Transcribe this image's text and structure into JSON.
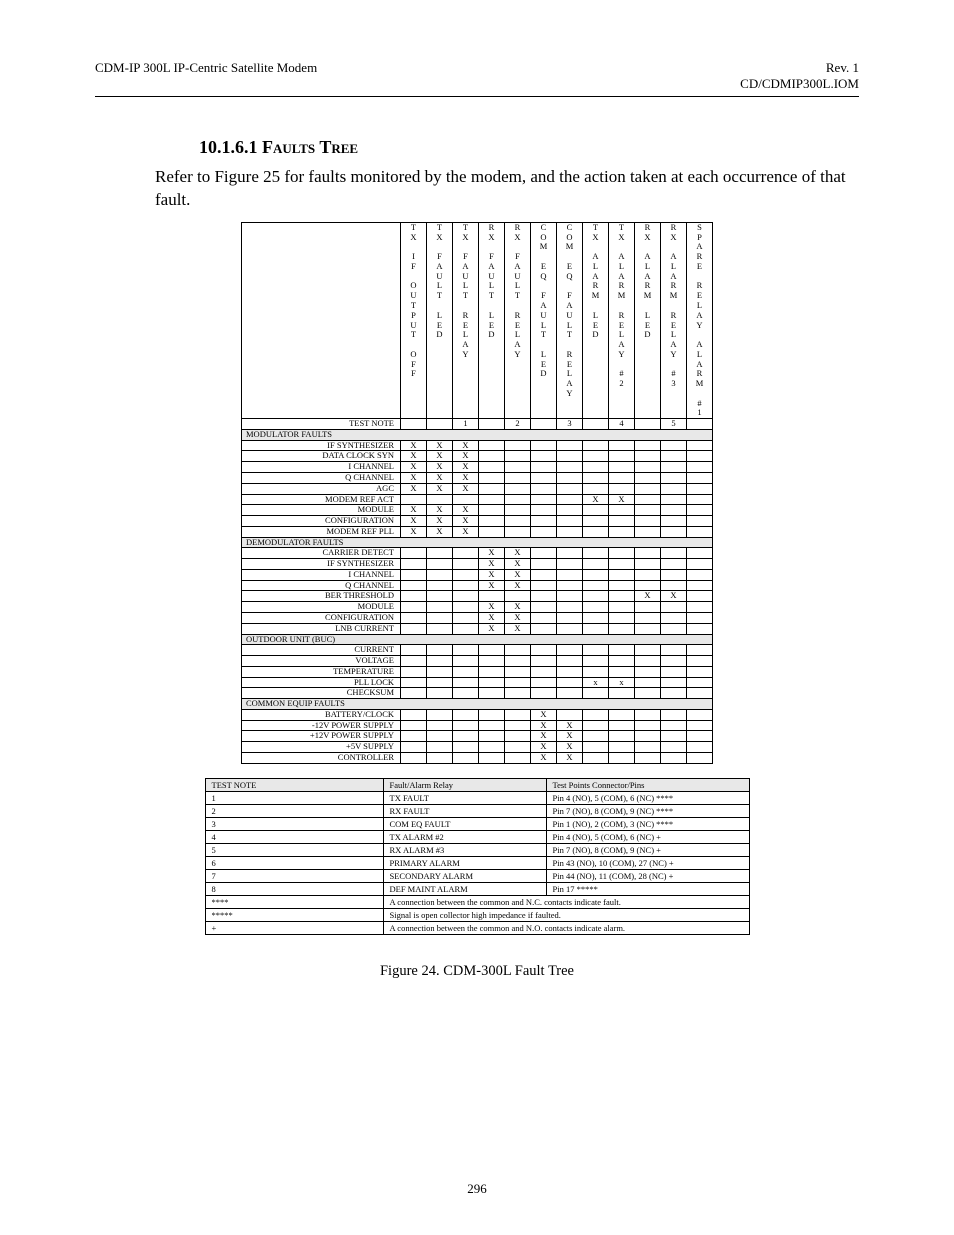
{
  "header": {
    "left": "CDM-IP 300L IP-Centric Satellite Modem",
    "right1": "Rev. 1",
    "right2": "CD/CDMIP300L.IOM"
  },
  "heading": {
    "number": "10.1.6.1 ",
    "title": "Faults Tree"
  },
  "intro": "Refer to Figure 25 for faults monitored by the modem, and the action taken at each occurrence of that fault.",
  "caption": "Figure 24.  CDM-300L Fault Tree",
  "page_number": "296",
  "columns": [
    "TX IF OUTPUT OFF",
    "TX FAULT LED",
    "TX FAULT RELAY",
    "RX FAULT LED",
    "RX FAULT RELAY",
    "COM EQ FAULT LED",
    "COM EQ FAULT RELAY",
    "TX ALARM LED",
    "TX ALARM RELAY #2",
    "RX ALARM LED",
    "RX ALARM RELAY #3",
    "SPARE RELAY ALARM #1"
  ],
  "test_note_row": {
    "label": "TEST NOTE",
    "cells": [
      "",
      "",
      "1",
      "",
      "2",
      "",
      "3",
      "",
      "4",
      "",
      "5",
      ""
    ]
  },
  "sections": [
    {
      "title": "MODULATOR FAULTS",
      "rows": [
        {
          "label": "IF SYNTHESIZER",
          "cells": [
            "X",
            "X",
            "X",
            "",
            "",
            "",
            "",
            "",
            "",
            "",
            "",
            ""
          ]
        },
        {
          "label": "DATA CLOCK SYN",
          "cells": [
            "X",
            "X",
            "X",
            "",
            "",
            "",
            "",
            "",
            "",
            "",
            "",
            ""
          ]
        },
        {
          "label": "I CHANNEL",
          "cells": [
            "X",
            "X",
            "X",
            "",
            "",
            "",
            "",
            "",
            "",
            "",
            "",
            ""
          ]
        },
        {
          "label": "Q CHANNEL",
          "cells": [
            "X",
            "X",
            "X",
            "",
            "",
            "",
            "",
            "",
            "",
            "",
            "",
            ""
          ]
        },
        {
          "label": "AGC",
          "cells": [
            "X",
            "X",
            "X",
            "",
            "",
            "",
            "",
            "",
            "",
            "",
            "",
            ""
          ]
        },
        {
          "label": "MODEM REF ACT",
          "cells": [
            "",
            "",
            "",
            "",
            "",
            "",
            "",
            "X",
            "X",
            "",
            "",
            ""
          ]
        },
        {
          "label": "MODULE",
          "cells": [
            "X",
            "X",
            "X",
            "",
            "",
            "",
            "",
            "",
            "",
            "",
            "",
            ""
          ]
        },
        {
          "label": "CONFIGURATION",
          "cells": [
            "X",
            "X",
            "X",
            "",
            "",
            "",
            "",
            "",
            "",
            "",
            "",
            ""
          ]
        },
        {
          "label": "MODEM REF PLL",
          "cells": [
            "X",
            "X",
            "X",
            "",
            "",
            "",
            "",
            "",
            "",
            "",
            "",
            ""
          ]
        }
      ]
    },
    {
      "title": "DEMODULATOR FAULTS",
      "rows": [
        {
          "label": "CARRIER DETECT",
          "cells": [
            "",
            "",
            "",
            "X",
            "X",
            "",
            "",
            "",
            "",
            "",
            "",
            ""
          ]
        },
        {
          "label": "IF SYNTHESIZER",
          "cells": [
            "",
            "",
            "",
            "X",
            "X",
            "",
            "",
            "",
            "",
            "",
            "",
            ""
          ]
        },
        {
          "label": "I CHANNEL",
          "cells": [
            "",
            "",
            "",
            "X",
            "X",
            "",
            "",
            "",
            "",
            "",
            "",
            ""
          ]
        },
        {
          "label": "Q CHANNEL",
          "cells": [
            "",
            "",
            "",
            "X",
            "X",
            "",
            "",
            "",
            "",
            "",
            "",
            ""
          ]
        },
        {
          "label": "BER THRESHOLD",
          "cells": [
            "",
            "",
            "",
            "",
            "",
            "",
            "",
            "",
            "",
            "X",
            "X",
            ""
          ]
        },
        {
          "label": "MODULE",
          "cells": [
            "",
            "",
            "",
            "X",
            "X",
            "",
            "",
            "",
            "",
            "",
            "",
            ""
          ]
        },
        {
          "label": "CONFIGURATION",
          "cells": [
            "",
            "",
            "",
            "X",
            "X",
            "",
            "",
            "",
            "",
            "",
            "",
            ""
          ]
        },
        {
          "label": "LNB CURRENT",
          "cells": [
            "",
            "",
            "",
            "X",
            "X",
            "",
            "",
            "",
            "",
            "",
            "",
            ""
          ]
        }
      ]
    },
    {
      "title": "OUTDOOR UNIT (BUC)",
      "rows": [
        {
          "label": "CURRENT",
          "cells": [
            "",
            "",
            "",
            "",
            "",
            "",
            "",
            "",
            "",
            "",
            "",
            ""
          ]
        },
        {
          "label": "VOLTAGE",
          "cells": [
            "",
            "",
            "",
            "",
            "",
            "",
            "",
            "",
            "",
            "",
            "",
            ""
          ]
        },
        {
          "label": "TEMPERATURE",
          "cells": [
            "",
            "",
            "",
            "",
            "",
            "",
            "",
            "",
            "",
            "",
            "",
            ""
          ]
        },
        {
          "label": "PLL LOCK",
          "cells": [
            "",
            "",
            "",
            "",
            "",
            "",
            "",
            "x",
            "x",
            "",
            "",
            ""
          ]
        },
        {
          "label": "CHECKSUM",
          "cells": [
            "",
            "",
            "",
            "",
            "",
            "",
            "",
            "",
            "",
            "",
            "",
            ""
          ]
        }
      ]
    },
    {
      "title": "COMMON EQUIP FAULTS",
      "rows": [
        {
          "label": "BATTERY/CLOCK",
          "cells": [
            "",
            "",
            "",
            "",
            "",
            "X",
            "",
            "",
            "",
            "",
            "",
            ""
          ]
        },
        {
          "label": "-12V POWER SUPPLY",
          "cells": [
            "",
            "",
            "",
            "",
            "",
            "X",
            "X",
            "",
            "",
            "",
            "",
            ""
          ]
        },
        {
          "label": "+12V POWER SUPPLY",
          "cells": [
            "",
            "",
            "",
            "",
            "",
            "X",
            "X",
            "",
            "",
            "",
            "",
            ""
          ]
        },
        {
          "label": "+5V SUPPLY",
          "cells": [
            "",
            "",
            "",
            "",
            "",
            "X",
            "X",
            "",
            "",
            "",
            "",
            ""
          ]
        },
        {
          "label": "CONTROLLER",
          "cells": [
            "",
            "",
            "",
            "",
            "",
            "X",
            "X",
            "",
            "",
            "",
            "",
            ""
          ]
        }
      ]
    }
  ],
  "notes": {
    "header": [
      "TEST NOTE",
      "Fault/Alarm Relay",
      "Test Points Connector/Pins"
    ],
    "rows": [
      [
        "1",
        "TX FAULT",
        "Pin 4 (NO), 5 (COM), 6 (NC) ****"
      ],
      [
        "2",
        "RX FAULT",
        "Pin 7 (NO), 8 (COM), 9 (NC) ****"
      ],
      [
        "3",
        "COM EQ FAULT",
        "Pin 1 (NO), 2 (COM), 3 (NC) ****"
      ],
      [
        "4",
        "TX ALARM #2",
        "Pin 4 (NO), 5 (COM), 6 (NC) +"
      ],
      [
        "5",
        "RX ALARM #3",
        "Pin 7 (NO), 8 (COM), 9 (NC) +"
      ],
      [
        "6",
        "PRIMARY ALARM",
        "Pin 43 (NO), 10 (COM), 27 (NC) +"
      ],
      [
        "7",
        "SECONDARY ALARM",
        "Pin 44 (NO), 11 (COM), 28 (NC) +"
      ],
      [
        "8",
        "DEF MAINT ALARM",
        "Pin 17 *****"
      ]
    ],
    "footer": [
      [
        "****",
        "A connection between the common and N.C. contacts indicate fault."
      ],
      [
        "*****",
        "Signal is open collector high impedance if faulted."
      ],
      [
        "+",
        "A connection between the common and N.O. contacts indicate alarm."
      ]
    ]
  }
}
